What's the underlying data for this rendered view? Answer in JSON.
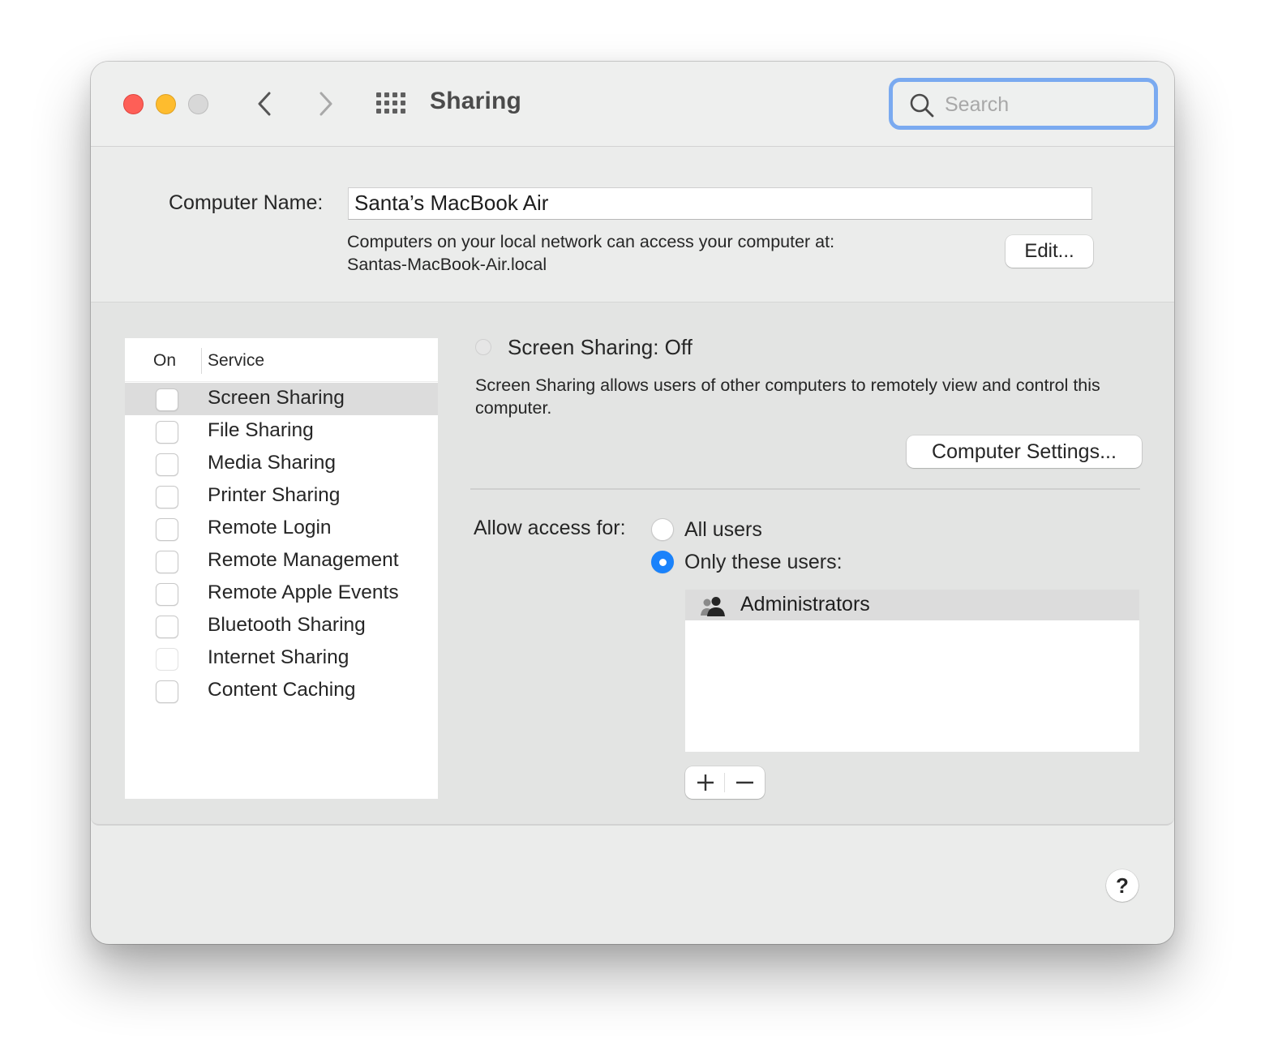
{
  "window": {
    "title": "Sharing",
    "traffic_lights": {
      "close_color": "#fe5f57",
      "minimize_color": "#febc2e",
      "zoom_color": "#d8d8d8"
    },
    "nav": {
      "back_icon": "chevron-left-icon",
      "forward_icon": "chevron-right-icon",
      "grid_icon": "show-all-grid-icon"
    },
    "search": {
      "placeholder": "Search",
      "value": "",
      "focus_ring_color": "#7aaaf0"
    }
  },
  "computer_name": {
    "label": "Computer Name:",
    "value": "Santa’s MacBook Air",
    "info_line1": "Computers on your local network can access your computer at:",
    "info_line2": "Santas-MacBook-Air.local",
    "edit_button": "Edit..."
  },
  "services": {
    "header_on": "On",
    "header_service": "Service",
    "selected_index": 0,
    "items": [
      {
        "name": "Screen Sharing",
        "on": false,
        "enabled": true
      },
      {
        "name": "File Sharing",
        "on": false,
        "enabled": true
      },
      {
        "name": "Media Sharing",
        "on": false,
        "enabled": true
      },
      {
        "name": "Printer Sharing",
        "on": false,
        "enabled": true
      },
      {
        "name": "Remote Login",
        "on": false,
        "enabled": true
      },
      {
        "name": "Remote Management",
        "on": false,
        "enabled": true
      },
      {
        "name": "Remote Apple Events",
        "on": false,
        "enabled": true
      },
      {
        "name": "Bluetooth Sharing",
        "on": false,
        "enabled": true
      },
      {
        "name": "Internet Sharing",
        "on": false,
        "enabled": false
      },
      {
        "name": "Content Caching",
        "on": false,
        "enabled": true
      }
    ]
  },
  "detail": {
    "status": "Screen Sharing: Off",
    "description": "Screen Sharing allows users of other computers to remotely view and control this computer.",
    "computer_settings_button": "Computer Settings...",
    "allow_access_label": "Allow access for:",
    "options": [
      {
        "label": "All users",
        "checked": false
      },
      {
        "label": "Only these users:",
        "checked": true
      }
    ],
    "accent_color": "#1a82fb",
    "users": [
      {
        "name": "Administrators",
        "icon": "group-icon",
        "selected": true
      }
    ],
    "add_button": "+",
    "remove_button": "−"
  },
  "help_button": "?"
}
